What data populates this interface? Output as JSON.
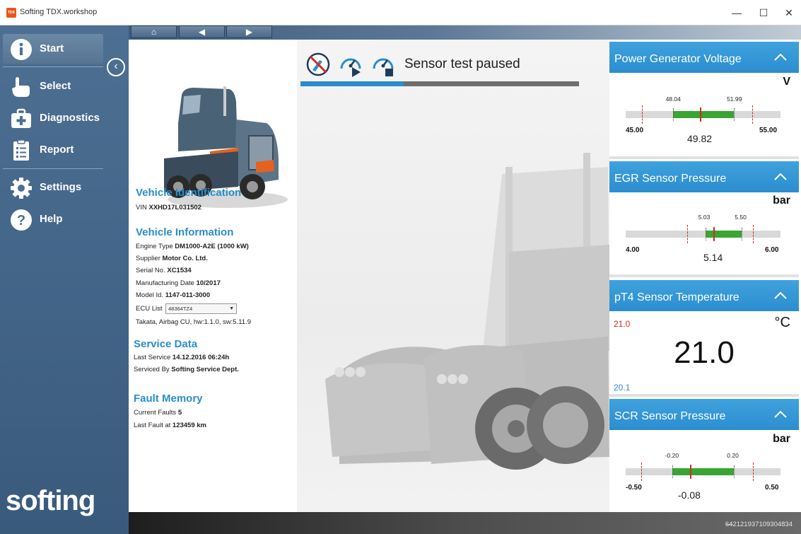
{
  "window": {
    "title": "Softing TDX.workshop",
    "logo_text": "TDX",
    "minimize": "—",
    "maximize": "☐",
    "close": "✕"
  },
  "sidebar": {
    "items": [
      {
        "label": "Start",
        "icon": "info-icon"
      },
      {
        "label": "Select",
        "icon": "hand-pointer-icon"
      },
      {
        "label": "Diagnostics",
        "icon": "medical-kit-icon"
      },
      {
        "label": "Report",
        "icon": "clipboard-list-icon"
      },
      {
        "label": "Settings",
        "icon": "gear-icon"
      },
      {
        "label": "Help",
        "icon": "question-icon"
      }
    ],
    "collapse_glyph": "‹",
    "brand": "softing"
  },
  "topnav": {
    "home": "⌂",
    "back": "◀",
    "forward": "▶"
  },
  "vehicle": {
    "identification_title": "Vehicle Identification",
    "vin_label": "VIN",
    "vin": "XXHD17L031502",
    "information_title": "Vehicle Information",
    "engine_type_label": "Engine Type",
    "engine_type": "DM1000-A2E (1000 kW)",
    "supplier_label": "Supplier",
    "supplier": "Motor Co. Ltd.",
    "serial_label": "Serial No.",
    "serial": "XC1534",
    "mfg_date_label": "Manufacturing Date",
    "mfg_date": "10/2017",
    "model_id_label": "Model Id.",
    "model_id": "1147-011-3000",
    "ecu_label": "ECU List",
    "ecu_value": "48364TZ4",
    "ecu_info": "Takata, Airbag CU, hw:1.1.0, sw:5.11.9",
    "service_title": "Service Data",
    "last_service_label": "Last Service",
    "last_service": "14.12.2016 06:24h",
    "serviced_by_label": "Serviced By",
    "serviced_by": "Softing Service Dept.",
    "fault_title": "Fault Memory",
    "current_faults_label": "Current Faults",
    "current_faults": "5",
    "last_fault_label": "Last Fault at",
    "last_fault": "123459 km"
  },
  "sensor_test": {
    "status": "Sensor test paused",
    "progress": 0.37,
    "icons": [
      "stop-test-icon",
      "gauge-play-icon",
      "gauge-stop-icon"
    ]
  },
  "widgets": {
    "power": {
      "title": "Power Generator Voltage",
      "unit": "V",
      "min": "45.00",
      "max": "55.00",
      "low": "48.04",
      "high": "51.99",
      "value": "49.82",
      "minN": 45,
      "maxN": 55,
      "lowN": 48.04,
      "highN": 51.99,
      "valueN": 49.82
    },
    "egr": {
      "title": "EGR Sensor Pressure",
      "unit": "bar",
      "min": "4.00",
      "max": "6.00",
      "low": "5.03",
      "high": "5.50",
      "value": "5.14",
      "minN": 4,
      "maxN": 6,
      "lowN": 5.03,
      "highN": 5.5,
      "valueN": 5.14
    },
    "pt4": {
      "title": "pT4 Sensor Temperature",
      "unit": "°C",
      "max": "21.0",
      "min": "20.1",
      "value": "21.0"
    },
    "scr": {
      "title": "SCR Sensor Pressure",
      "unit": "bar",
      "min": "-0.50",
      "max": "0.50",
      "low": "-0.20",
      "high": "0.20",
      "value": "-0.08",
      "minN": -0.5,
      "maxN": 0.5,
      "lowN": -0.2,
      "highN": 0.2,
      "valueN": -0.08
    }
  },
  "statusbar": {
    "dots": "---",
    "code": "642121937109304834"
  },
  "colors": {
    "accent": "#2a8dcc",
    "sidebar": "#426487",
    "gauge_green": "#3aa532",
    "needle": "#d52a1f"
  }
}
